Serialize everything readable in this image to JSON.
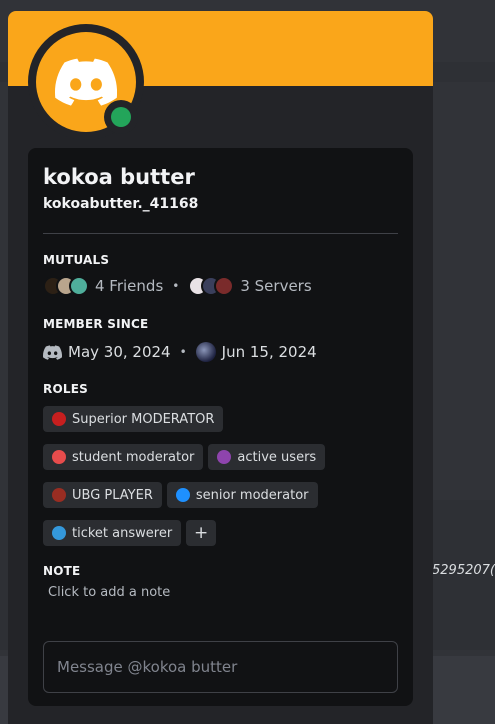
{
  "background": {
    "partial_number": "5295207("
  },
  "profile": {
    "display_name": "kokoa butter",
    "username": "kokoabutter._41168",
    "status_color": "#23a55a",
    "banner_color": "#faa61a"
  },
  "mutuals": {
    "title": "MUTUALS",
    "friends_label": "4 Friends",
    "bullet": "•",
    "servers_label": "3 Servers"
  },
  "member_since": {
    "title": "MEMBER SINCE",
    "discord_date": "May 30, 2024",
    "bullet": "•",
    "server_date": "Jun 15, 2024"
  },
  "roles": {
    "title": "ROLES",
    "items": [
      {
        "label": "Superior MODERATOR",
        "color": "#c71f1f"
      },
      {
        "label": "student moderator",
        "color": "#e74c4c"
      },
      {
        "label": "active users",
        "color": "#8e44ad"
      },
      {
        "label": "UBG PLAYER",
        "color": "#992d22"
      },
      {
        "label": "senior moderator",
        "color": "#1e90ff"
      },
      {
        "label": "ticket answerer",
        "color": "#3498db"
      }
    ],
    "add_label": "+"
  },
  "note": {
    "title": "NOTE",
    "placeholder": "Click to add a note"
  },
  "message": {
    "placeholder": "Message @kokoa butter"
  }
}
